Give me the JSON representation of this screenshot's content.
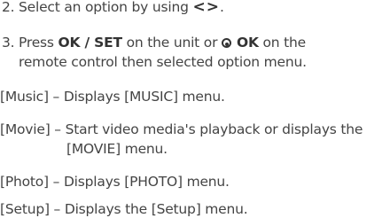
{
  "steps": [
    {
      "number": "2.",
      "text_before": "Select an option by using ",
      "arrows_glyph": "<>",
      "text_after": "."
    },
    {
      "number": "3.",
      "text_before": "Press ",
      "ok_set_label": "OK / SET",
      "text_middle": " on the unit or ",
      "ok_icon": "circle-dot-icon",
      "ok_label": "OK",
      "text_after": " on the",
      "continuation": "remote control then selected option menu."
    }
  ],
  "options": [
    {
      "term": "[Music]",
      "description": "Displays [MUSIC] menu."
    },
    {
      "term": "[Movie]",
      "description": "Start video media's playback or displays the",
      "continuation": "[MOVIE] menu."
    },
    {
      "term": "[Photo]",
      "description": "Displays [PHOTO] menu."
    },
    {
      "term": "[Setup]",
      "description": "Displays the [Setup] menu."
    }
  ],
  "separator": " – "
}
